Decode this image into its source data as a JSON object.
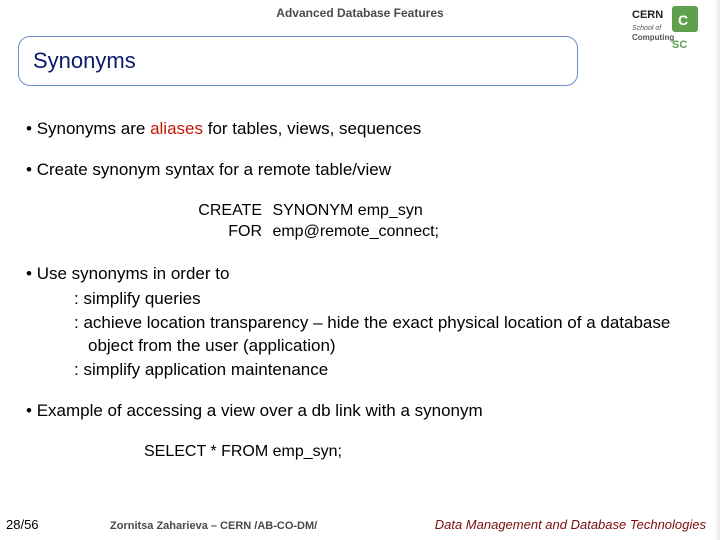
{
  "header": {
    "course": "Advanced Database Features",
    "logo_top": "CERN",
    "logo_mid": "School of",
    "logo_bot": "Computing"
  },
  "title": "Synonyms",
  "b1": {
    "pre": "Synonyms are ",
    "hl": "aliases",
    "post": " for tables, views, sequences"
  },
  "b2": "Create synonym syntax for a remote table/view",
  "code1": {
    "l1k": "CREATE",
    "l1v": "  SYNONYM emp_syn",
    "l2k": "FOR",
    "l2v": "  emp@remote_connect;"
  },
  "b3": "Use synonyms in order to",
  "sub": {
    "s1": ": simplify queries",
    "s2": ": achieve location transparency – hide the exact physical location of a database object from the user (application)",
    "s3": ": simplify application maintenance"
  },
  "b4": "Example of accessing a view over a db link with a synonym",
  "code2": "SELECT  * FROM  emp_syn;",
  "footer": {
    "page": "28/56",
    "author": "Zornitsa Zaharieva – CERN /AB-CO-DM/",
    "right": "Data Management and Database Technologies"
  }
}
